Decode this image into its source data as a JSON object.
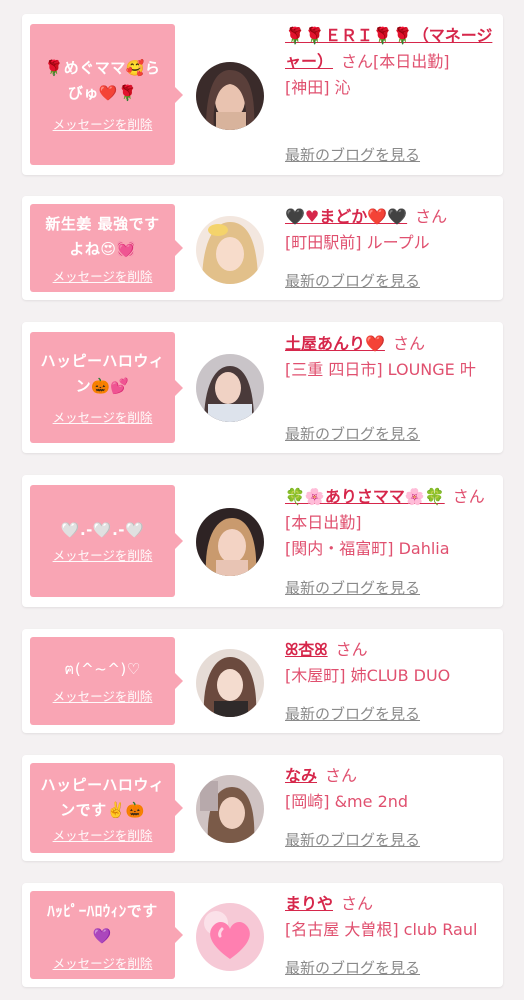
{
  "accent_color": "#f9a5b4",
  "name_color": "#d6274b",
  "cards": [
    {
      "message": "🌹めぐママ🥰らびゅ❤️🌹",
      "delete_label": "メッセージを削除",
      "avatar": "avatar-photo",
      "name": "🌹🌹ＥＲＩ🌹🌹（マネージャー）",
      "honorific": "さん",
      "status": "[本日出勤]",
      "shop": "[神田] 沁",
      "blog_label": "最新のブログを見る"
    },
    {
      "message": "新生姜 最強ですよね😍💓",
      "delete_label": "メッセージを削除",
      "avatar": "avatar-photo",
      "name": "🖤♥まどか❤️🖤",
      "honorific": "さん",
      "status": "",
      "shop": "[町田駅前] ループル",
      "blog_label": "最新のブログを見る"
    },
    {
      "message": "ハッピーハロウィン🎃💕",
      "delete_label": "メッセージを削除",
      "avatar": "avatar-photo",
      "name": "土屋あんり❤️",
      "honorific": "さん",
      "status": "",
      "shop": "[三重 四日市] LOUNGE 叶",
      "blog_label": "最新のブログを見る"
    },
    {
      "message": "🤍.-🤍.-🤍",
      "delete_label": "メッセージを削除",
      "avatar": "avatar-photo",
      "name": "🍀🌸ありさママ🌸🍀",
      "honorific": "さん",
      "status": "[本日出勤]",
      "shop": "[関内・福富町] Dahlia",
      "blog_label": "最新のブログを見る"
    },
    {
      "message": "ฅ(^~^)♡",
      "delete_label": "メッセージを削除",
      "avatar": "avatar-photo",
      "name": "ꕤ杏ꕤ",
      "honorific": "さん",
      "status": "",
      "shop": "[木屋町] 姉CLUB DUO",
      "blog_label": "最新のブログを見る"
    },
    {
      "message": "ハッピーハロウィンです✌️🎃",
      "delete_label": "メッセージを削除",
      "avatar": "avatar-photo",
      "name": "なみ",
      "honorific": "さん",
      "status": "",
      "shop": "[岡崎] &me 2nd",
      "blog_label": "最新のブログを見る"
    },
    {
      "message": "ﾊｯﾋﾟｰﾊﾛｳｨﾝです💜",
      "delete_label": "メッセージを削除",
      "avatar": "heart-avatar",
      "name": "まりや",
      "honorific": "さん",
      "status": "",
      "shop": "[名古屋 大曽根] club Raul",
      "blog_label": "最新のブログを見る"
    }
  ]
}
